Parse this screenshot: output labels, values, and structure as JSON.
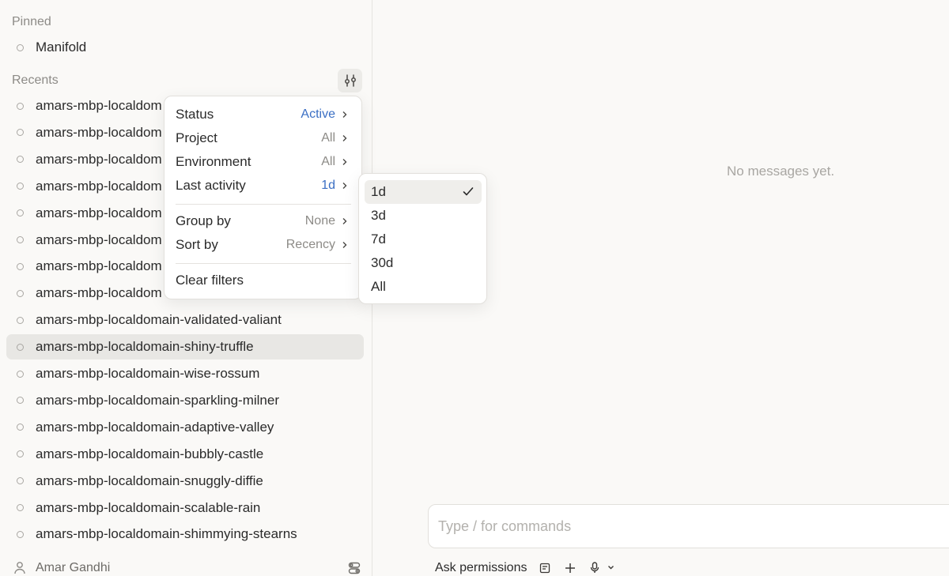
{
  "sidebar": {
    "pinned_label": "Pinned",
    "pinned_items": [
      {
        "label": "Manifold"
      }
    ],
    "recents_label": "Recents",
    "recents_items": [
      {
        "label": "amars-mbp-localdom"
      },
      {
        "label": "amars-mbp-localdom"
      },
      {
        "label": "amars-mbp-localdom"
      },
      {
        "label": "amars-mbp-localdom"
      },
      {
        "label": "amars-mbp-localdom"
      },
      {
        "label": "amars-mbp-localdom"
      },
      {
        "label": "amars-mbp-localdom"
      },
      {
        "label": "amars-mbp-localdom"
      },
      {
        "label": "amars-mbp-localdomain-validated-valiant"
      },
      {
        "label": "amars-mbp-localdomain-shiny-truffle"
      },
      {
        "label": "amars-mbp-localdomain-wise-rossum"
      },
      {
        "label": "amars-mbp-localdomain-sparkling-milner"
      },
      {
        "label": "amars-mbp-localdomain-adaptive-valley"
      },
      {
        "label": "amars-mbp-localdomain-bubbly-castle"
      },
      {
        "label": "amars-mbp-localdomain-snuggly-diffie"
      },
      {
        "label": "amars-mbp-localdomain-scalable-rain"
      },
      {
        "label": "amars-mbp-localdomain-shimmying-stearns"
      }
    ],
    "selected_index": 9,
    "user_name": "Amar Gandhi"
  },
  "filter_menu": {
    "status": {
      "label": "Status",
      "value": "Active"
    },
    "project": {
      "label": "Project",
      "value": "All"
    },
    "environment": {
      "label": "Environment",
      "value": "All"
    },
    "last_activity": {
      "label": "Last activity",
      "value": "1d"
    },
    "group_by": {
      "label": "Group by",
      "value": "None"
    },
    "sort_by": {
      "label": "Sort by",
      "value": "Recency"
    },
    "clear_filters": "Clear filters"
  },
  "last_activity_submenu": {
    "options": [
      "1d",
      "3d",
      "7d",
      "30d",
      "All"
    ],
    "selected": "1d"
  },
  "main": {
    "empty_message": "No messages yet.",
    "composer_placeholder": "Type / for commands",
    "permissions_label": "Ask permissions"
  },
  "colors": {
    "accent": "#3b6fc4",
    "selected_row": "#e8e7e4",
    "background": "#faf9f7"
  }
}
